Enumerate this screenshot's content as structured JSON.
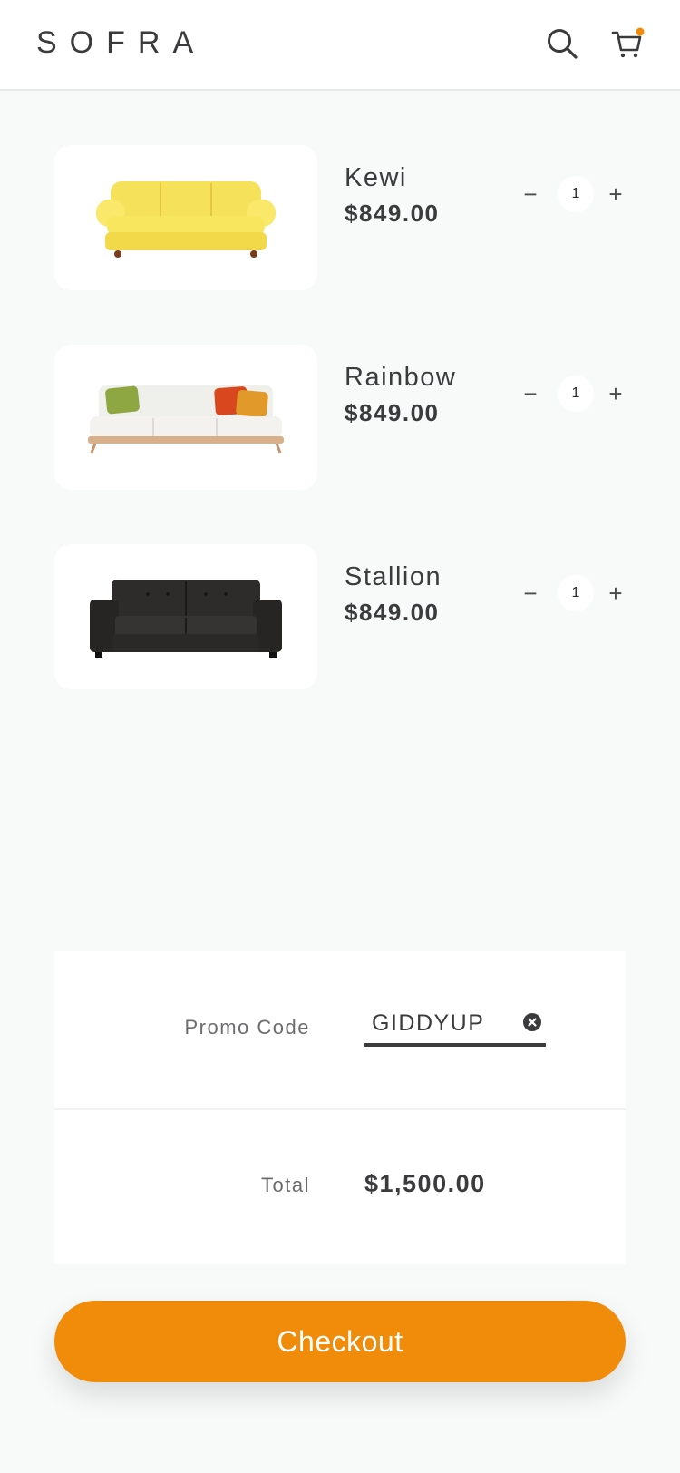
{
  "header": {
    "logo": "SOFRA",
    "search_icon": "search-icon",
    "cart_icon": "cart-icon",
    "cart_badge_color": "#f08c0a"
  },
  "items": [
    {
      "name": "Kewi",
      "price": "$849.00",
      "quantity": "1",
      "minus": "−",
      "plus": "+",
      "image": "yellow-sofa"
    },
    {
      "name": "Rainbow",
      "price": "$849.00",
      "quantity": "1",
      "minus": "−",
      "plus": "+",
      "image": "white-sofa-with-pillows"
    },
    {
      "name": "Stallion",
      "price": "$849.00",
      "quantity": "1",
      "minus": "−",
      "plus": "+",
      "image": "black-leather-sofa"
    }
  ],
  "summary": {
    "promo_label": "Promo Code",
    "promo_value": "GIDDYUP",
    "total_label": "Total",
    "total_value": "$1,500.00"
  },
  "checkout": {
    "label": "Checkout"
  },
  "colors": {
    "accent": "#f08c0a",
    "text": "#3b3b3d",
    "background": "#f8f9f9"
  }
}
